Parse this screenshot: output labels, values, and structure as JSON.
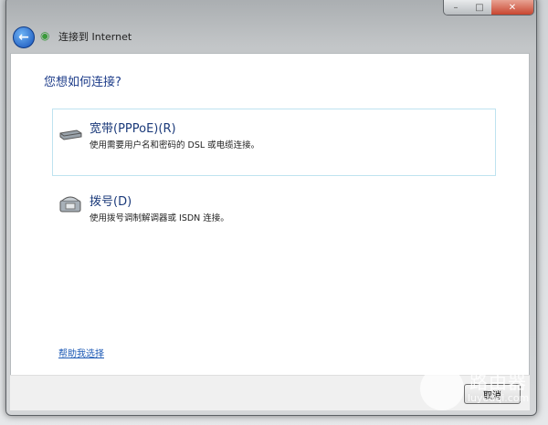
{
  "window": {
    "title": "连接到 Internet",
    "min": "–",
    "max": "□",
    "close": "✕"
  },
  "question": "您想如何连接?",
  "options": [
    {
      "title": "宽带(PPPoE)(R)",
      "desc": "使用需要用户名和密码的 DSL 或电缆连接。",
      "icon": "broadband-modem-icon"
    },
    {
      "title": "拨号(D)",
      "desc": "使用拨号调制解调器或 ISDN 连接。",
      "icon": "dialup-phone-icon"
    }
  ],
  "help_link": "帮助我选择",
  "cancel_label": "取消",
  "watermark": {
    "text": "路由器",
    "url": "luyouqi.com"
  }
}
